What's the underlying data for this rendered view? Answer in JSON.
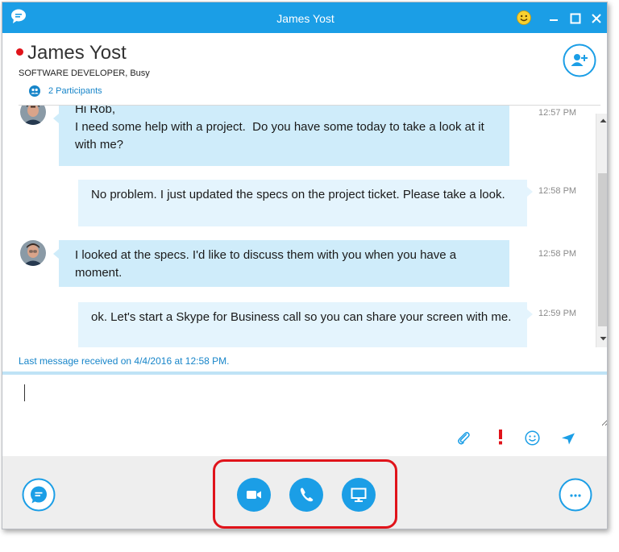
{
  "window": {
    "title": "James Yost",
    "accent_color": "#1b9ee6",
    "title_icons": [
      "app-chat-logo-icon",
      "emoji-smiley-icon",
      "minimize-icon",
      "maximize-icon",
      "close-icon"
    ]
  },
  "header": {
    "contact_name": "James Yost",
    "presence_status_color": "#e0131a",
    "contact_subtitle": "SOFTWARE DEVELOPER, Busy",
    "participants_label": "2 Participants",
    "add_person_icon": "add-person-icon"
  },
  "conversation": {
    "messages": [
      {
        "sender": "contact",
        "text": "Hi Rob,\nI need some help with a project.  Do you have some today to take a look at it with me?",
        "time": "12:57 PM"
      },
      {
        "sender": "me",
        "text": "No problem.  I just updated the specs on the project ticket.  Please take a look.",
        "time": "12:58 PM"
      },
      {
        "sender": "contact",
        "text": "I looked at the specs.  I'd like to discuss them with you when you have a moment.",
        "time": "12:58 PM"
      },
      {
        "sender": "me",
        "text": "ok.  Let's start a Skype for Business call so you can share your screen with me.",
        "time": "12:59 PM"
      }
    ],
    "last_message_info": "Last message received on 4/4/2016 at 12:58 PM."
  },
  "compose": {
    "value": "",
    "tools": [
      "paperclip-icon",
      "importance-exclamation-icon",
      "emoji-icon",
      "send-icon"
    ]
  },
  "bottom_bar": {
    "buttons": [
      "chat-bubble-icon",
      "video-camera-icon",
      "phone-icon",
      "present-screen-icon",
      "more-options-icon"
    ],
    "highlight_color": "#e0131a"
  }
}
